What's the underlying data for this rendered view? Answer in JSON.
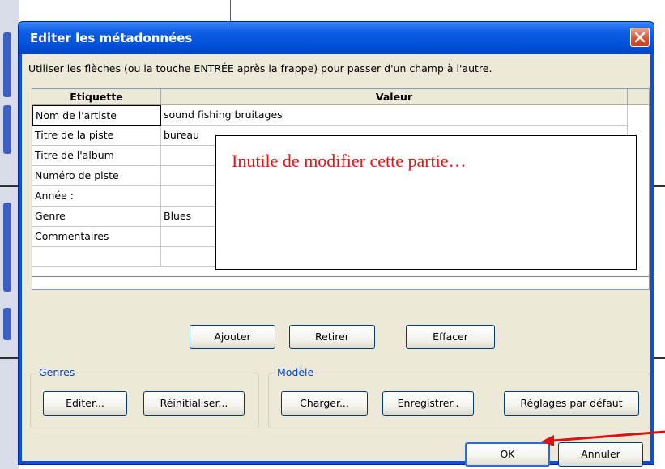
{
  "dialog": {
    "title": "Editer les métadonnées",
    "instructions": "Utiliser les flèches (ou la touche ENTRÉE après la frappe) pour passer d'un champ à l'autre."
  },
  "grid": {
    "columns": [
      "Etiquette",
      "Valeur"
    ],
    "rows": [
      {
        "label": "Nom de l'artiste",
        "value": "sound fishing bruitages"
      },
      {
        "label": "Titre de la piste",
        "value": "bureau"
      },
      {
        "label": "Titre de l'album",
        "value": ""
      },
      {
        "label": "Numéro de piste",
        "value": ""
      },
      {
        "label": "Année :",
        "value": ""
      },
      {
        "label": "Genre",
        "value": "Blues"
      },
      {
        "label": "Commentaires",
        "value": ""
      },
      {
        "label": "",
        "value": ""
      }
    ]
  },
  "annotation": {
    "text": "Inutile de modifier cette partie…",
    "text_color": "#ee1111",
    "arrow_color": "#dd1111"
  },
  "buttons": {
    "ajouter": "Ajouter",
    "retirer": "Retirer",
    "effacer": "Effacer",
    "editer": "Editer...",
    "reinitialiser": "Réinitialiser...",
    "charger": "Charger...",
    "enregistrer": "Enregistrer..",
    "reglages": "Réglages par défaut",
    "ok": "OK",
    "annuler": "Annuler"
  },
  "groups": {
    "genres": "Genres",
    "modele": "Modèle"
  },
  "colors": {
    "titlebar": "#0050d8",
    "client": "#ece9d8",
    "group_label": "#0046d5"
  }
}
